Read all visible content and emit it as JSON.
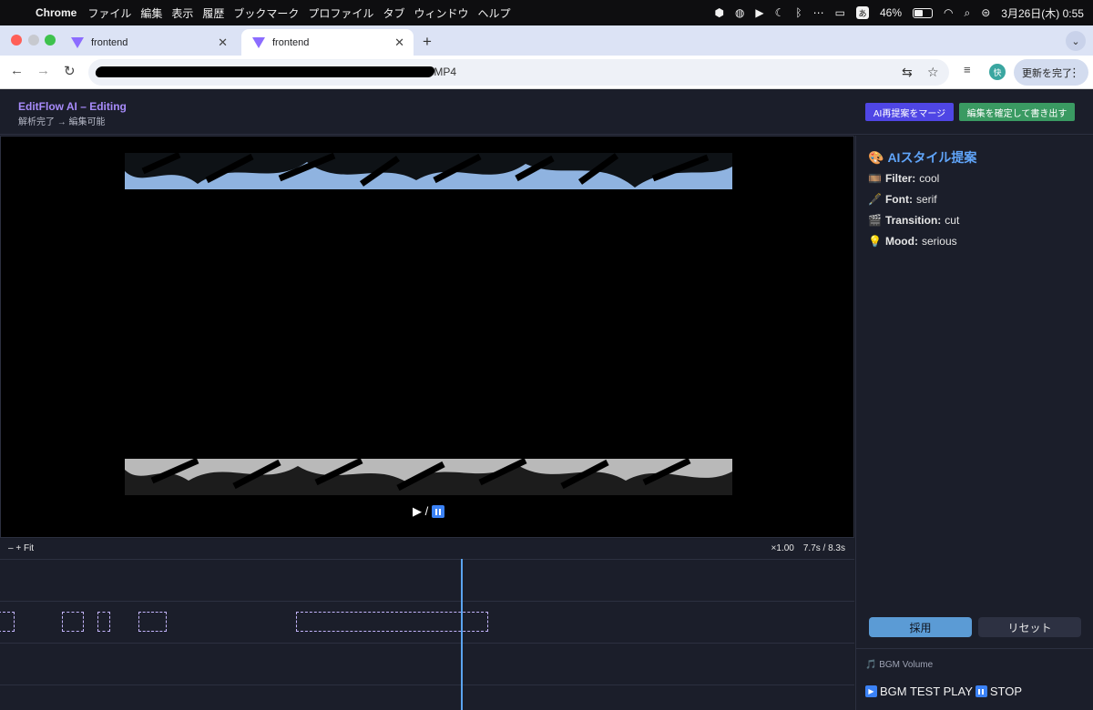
{
  "menubar": {
    "app": "Chrome",
    "items": [
      "ファイル",
      "編集",
      "表示",
      "履歴",
      "ブックマーク",
      "プロファイル",
      "タブ",
      "ウィンドウ",
      "ヘルプ"
    ],
    "input_method": "あ",
    "battery": "46%",
    "clock": "3月26日(木)  0:55"
  },
  "tabs": [
    {
      "title": "frontend",
      "active": false
    },
    {
      "title": "frontend",
      "active": true
    }
  ],
  "toolbar": {
    "url_suffix": ".MP4",
    "avatar": "快",
    "update_label": "更新を完了"
  },
  "app": {
    "title": "EditFlow AI – Editing",
    "status": "解析完了 → 編集可能",
    "merge_label": "AI再提案をマージ",
    "confirm_label": "編集を確定して書き出す"
  },
  "player": {
    "play_pause": "▶ /"
  },
  "zoom": {
    "controls": "– + Fit",
    "rate": "×1.00",
    "time": "7.7s / 8.3s",
    "progress": 0.928
  },
  "style_panel": {
    "title": "AIスタイル提案",
    "props": [
      {
        "icon": "film-icon",
        "label": "Filter:",
        "value": "cool"
      },
      {
        "icon": "pen-icon",
        "label": "Font:",
        "value": "serif"
      },
      {
        "icon": "clapper-icon",
        "label": "Transition:",
        "value": "cut"
      },
      {
        "icon": "lightbulb-icon",
        "label": "Mood:",
        "value": "serious"
      }
    ],
    "apply_label": "採用",
    "reset_label": "リセット"
  },
  "bgm": {
    "volume_label": "🎵 BGM Volume",
    "test_label": "BGM TEST PLAY",
    "stop_label": "STOP"
  }
}
